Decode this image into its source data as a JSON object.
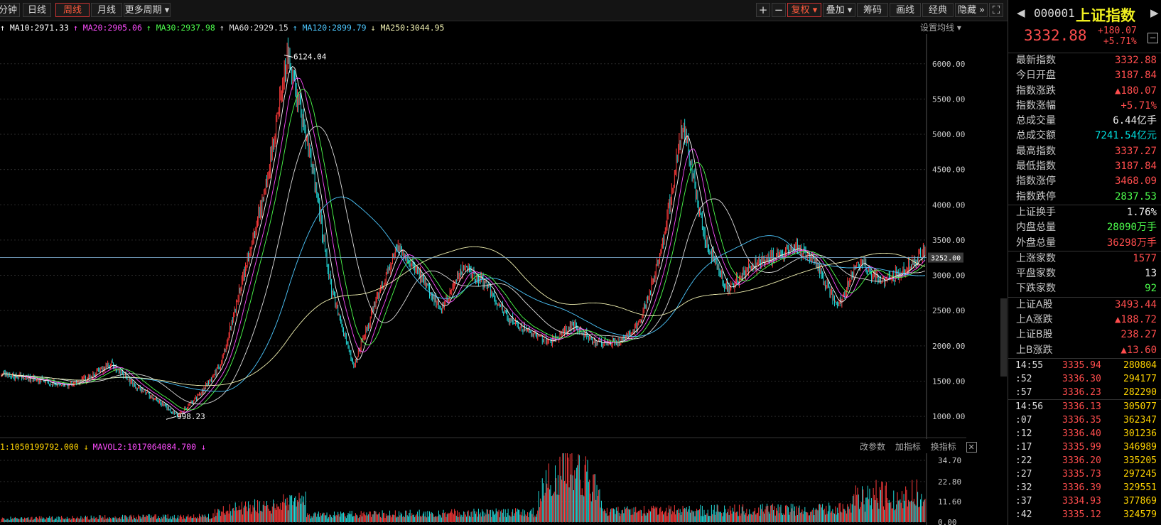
{
  "toolbar": {
    "periods": [
      "分钟",
      "日线",
      "周线",
      "月线",
      "更多周期 ▾"
    ],
    "active": "周线",
    "zoom_in": "+",
    "zoom_out": "−",
    "right_tools": [
      "复权 ▾",
      "叠加 ▾",
      "筹码",
      "画线",
      "经典",
      "隐藏 »"
    ],
    "fullscreen": "⛶"
  },
  "ma_legend": [
    {
      "label": "MA10:2971.33",
      "arrow": "↑",
      "color": "#ffffff"
    },
    {
      "label": "MA20:2905.06",
      "arrow": "↑",
      "color": "#ff4dff"
    },
    {
      "label": "MA30:2937.98",
      "arrow": "↑",
      "color": "#4dff4d"
    },
    {
      "label": "MA60:2929.15",
      "arrow": "↑",
      "color": "#dddddd"
    },
    {
      "label": "MA120:2899.79",
      "arrow": "↑",
      "color": "#4dc8ff"
    },
    {
      "label": "MA250:3044.95",
      "arrow": "↓",
      "color": "#f0f0b0"
    }
  ],
  "ma_settings": "设置均线 ▾",
  "vol_legend": [
    {
      "label": "1:1050199792.000",
      "arrow": "↓",
      "color": "#ffd400"
    },
    {
      "label": "MAVOL2:1017064084.700",
      "arrow": "↓",
      "color": "#ff4dff"
    }
  ],
  "vol_tools": [
    "改参数",
    "加指标",
    "换指标"
  ],
  "vol_close": "✕",
  "annotations": {
    "high": "6124.04",
    "low": "998.23",
    "current_price_tag": "3252.00"
  },
  "y_axis": [
    "6000.00",
    "5500.00",
    "5000.00",
    "4500.00",
    "4000.00",
    "3500.00",
    "3000.00",
    "2500.00",
    "2000.00",
    "1500.00",
    "1000.00"
  ],
  "vol_axis": [
    "34.70",
    "22.80",
    "11.60",
    "0.00"
  ],
  "chart_data": {
    "type": "candlestick",
    "period": "周线",
    "ylim": [
      900,
      6300
    ],
    "approx_close_path": [
      {
        "x": "2000",
        "y": 1600
      },
      {
        "x": "2001a",
        "y": 1550
      },
      {
        "x": "2001b",
        "y": 1500
      },
      {
        "x": "2002",
        "y": 1420
      },
      {
        "x": "2003",
        "y": 1550
      },
      {
        "x": "2004a",
        "y": 1750
      },
      {
        "x": "2004b",
        "y": 1450
      },
      {
        "x": "2005a",
        "y": 1250
      },
      {
        "x": "2005b",
        "y": 1000
      },
      {
        "x": "2006a",
        "y": 1300
      },
      {
        "x": "2006b",
        "y": 1750
      },
      {
        "x": "2007a",
        "y": 3000
      },
      {
        "x": "2007b",
        "y": 4200
      },
      {
        "x": "2007c",
        "y": 6124
      },
      {
        "x": "2008a",
        "y": 4800
      },
      {
        "x": "2008b",
        "y": 2800
      },
      {
        "x": "2008c",
        "y": 1700
      },
      {
        "x": "2009a",
        "y": 2600
      },
      {
        "x": "2009b",
        "y": 3400
      },
      {
        "x": "2010a",
        "y": 3000
      },
      {
        "x": "2010b",
        "y": 2500
      },
      {
        "x": "2010c",
        "y": 3100
      },
      {
        "x": "2011a",
        "y": 2900
      },
      {
        "x": "2011b",
        "y": 2400
      },
      {
        "x": "2012a",
        "y": 2200
      },
      {
        "x": "2012b",
        "y": 2050
      },
      {
        "x": "2013a",
        "y": 2300
      },
      {
        "x": "2013b",
        "y": 2050
      },
      {
        "x": "2014a",
        "y": 2050
      },
      {
        "x": "2014b",
        "y": 2300
      },
      {
        "x": "2015a",
        "y": 3300
      },
      {
        "x": "2015b",
        "y": 5178
      },
      {
        "x": "2015c",
        "y": 3500
      },
      {
        "x": "2016a",
        "y": 2800
      },
      {
        "x": "2016b",
        "y": 3100
      },
      {
        "x": "2017a",
        "y": 3250
      },
      {
        "x": "2017b",
        "y": 3400
      },
      {
        "x": "2018a",
        "y": 3200
      },
      {
        "x": "2018b",
        "y": 2550
      },
      {
        "x": "2019a",
        "y": 3200
      },
      {
        "x": "2019b",
        "y": 2900
      },
      {
        "x": "2019c",
        "y": 3050
      },
      {
        "x": "2020",
        "y": 3332.88
      }
    ]
  },
  "panel": {
    "code": "000001",
    "name": "上证指数",
    "price": "3332.88",
    "change": "+180.07",
    "change_pct": "+5.71%",
    "rows1": [
      {
        "k": "最新指数",
        "v": "3332.88",
        "c": "#ff4d4d"
      },
      {
        "k": "今日开盘",
        "v": "3187.84",
        "c": "#ff4d4d"
      },
      {
        "k": "指数涨跌",
        "v": "▲180.07",
        "c": "#ff4d4d"
      },
      {
        "k": "指数涨幅",
        "v": "+5.71%",
        "c": "#ff4d4d"
      },
      {
        "k": "总成交量",
        "v": "6.44亿手",
        "c": "#f0f0f0"
      },
      {
        "k": "总成交额",
        "v": "7241.54亿元",
        "c": "#00e0e0"
      },
      {
        "k": "最高指数",
        "v": "3337.27",
        "c": "#ff4d4d"
      },
      {
        "k": "最低指数",
        "v": "3187.84",
        "c": "#ff4d4d"
      },
      {
        "k": "指数涨停",
        "v": "3468.09",
        "c": "#ff4d4d"
      },
      {
        "k": "指数跌停",
        "v": "2837.53",
        "c": "#4dff4d"
      }
    ],
    "rows2": [
      {
        "k": "上证换手",
        "v": "1.76%",
        "c": "#f0f0f0"
      },
      {
        "k": "内盘总量",
        "v": "28090万手",
        "c": "#4dff4d"
      },
      {
        "k": "外盘总量",
        "v": "36298万手",
        "c": "#ff4d4d"
      }
    ],
    "rows3": [
      {
        "k": "上涨家数",
        "v": "1577",
        "c": "#ff4d4d"
      },
      {
        "k": "平盘家数",
        "v": "13",
        "c": "#f0f0f0"
      },
      {
        "k": "下跌家数",
        "v": "92",
        "c": "#4dff4d"
      }
    ],
    "rows4": [
      {
        "k": "上证A股",
        "v": "3493.44",
        "c": "#ff4d4d"
      },
      {
        "k": "上A涨跌",
        "v": "▲188.72",
        "c": "#ff4d4d"
      },
      {
        "k": "上证B股",
        "v": "238.27",
        "c": "#ff4d4d"
      },
      {
        "k": "上B涨跌",
        "v": "▲13.60",
        "c": "#ff4d4d"
      }
    ],
    "ticks1": [
      {
        "t": "14:55",
        "p": "3335.94",
        "v": "280804"
      },
      {
        "t": ":52",
        "p": "3336.30",
        "v": "294177"
      },
      {
        "t": ":57",
        "p": "3336.23",
        "v": "282290"
      }
    ],
    "ticks2": [
      {
        "t": "14:56",
        "p": "3336.13",
        "v": "305077"
      },
      {
        "t": ":07",
        "p": "3336.35",
        "v": "362347"
      },
      {
        "t": ":12",
        "p": "3336.40",
        "v": "301236"
      },
      {
        "t": ":17",
        "p": "3335.99",
        "v": "346989"
      },
      {
        "t": ":22",
        "p": "3336.20",
        "v": "335205"
      },
      {
        "t": ":27",
        "p": "3335.73",
        "v": "297245"
      },
      {
        "t": ":32",
        "p": "3336.39",
        "v": "329551"
      },
      {
        "t": ":37",
        "p": "3334.93",
        "v": "377869"
      },
      {
        "t": ":42",
        "p": "3335.12",
        "v": "324579"
      }
    ]
  }
}
